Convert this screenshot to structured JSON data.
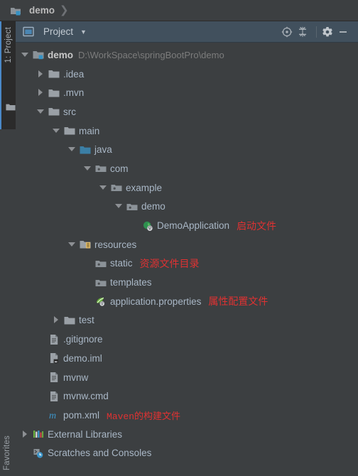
{
  "breadcrumb": {
    "items": [
      {
        "label": "demo",
        "icon": "module-folder-icon"
      }
    ],
    "separator": "❯"
  },
  "left_rail": {
    "project_tab_label": "1: Project",
    "favorites_label": "Favorites",
    "folder_icon": "folder-icon"
  },
  "tool_window": {
    "title": "Project",
    "title_icon": "project-window-icon",
    "dropdown_chevron": "▼",
    "buttons": [
      {
        "name": "locate-in-tree-button",
        "icon": "target-icon",
        "title": "Select Opened File"
      },
      {
        "name": "collapse-all-button",
        "icon": "collapse-all-icon",
        "title": "Collapse All"
      },
      {
        "name": "settings-button",
        "icon": "gear-icon",
        "title": "Settings"
      },
      {
        "name": "hide-button",
        "icon": "minimize-icon",
        "title": "Hide"
      }
    ]
  },
  "tree": {
    "rows": [
      {
        "indent": 0,
        "arrow": "expanded",
        "icon": "module-folder-icon",
        "label": "demo",
        "bold": true,
        "sub": "D:\\WorkSpace\\springBootPro\\demo",
        "note": ""
      },
      {
        "indent": 1,
        "arrow": "collapsed",
        "icon": "folder-icon",
        "label": ".idea",
        "bold": false,
        "sub": "",
        "note": ""
      },
      {
        "indent": 1,
        "arrow": "collapsed",
        "icon": "folder-icon",
        "label": ".mvn",
        "bold": false,
        "sub": "",
        "note": ""
      },
      {
        "indent": 1,
        "arrow": "expanded",
        "icon": "folder-icon",
        "label": "src",
        "bold": false,
        "sub": "",
        "note": ""
      },
      {
        "indent": 2,
        "arrow": "expanded",
        "icon": "folder-icon",
        "label": "main",
        "bold": false,
        "sub": "",
        "note": ""
      },
      {
        "indent": 3,
        "arrow": "expanded",
        "icon": "source-root-icon",
        "label": "java",
        "bold": false,
        "sub": "",
        "note": ""
      },
      {
        "indent": 4,
        "arrow": "expanded",
        "icon": "package-icon",
        "label": "com",
        "bold": false,
        "sub": "",
        "note": ""
      },
      {
        "indent": 5,
        "arrow": "expanded",
        "icon": "package-icon",
        "label": "example",
        "bold": false,
        "sub": "",
        "note": ""
      },
      {
        "indent": 6,
        "arrow": "expanded",
        "icon": "package-icon",
        "label": "demo",
        "bold": false,
        "sub": "",
        "note": ""
      },
      {
        "indent": 7,
        "arrow": "none",
        "icon": "spring-boot-class-icon",
        "label": "DemoApplication",
        "bold": false,
        "sub": "",
        "note": "启动文件"
      },
      {
        "indent": 3,
        "arrow": "expanded",
        "icon": "resource-root-icon",
        "label": "resources",
        "bold": false,
        "sub": "",
        "note": ""
      },
      {
        "indent": 4,
        "arrow": "none",
        "icon": "package-icon",
        "label": "static",
        "bold": false,
        "sub": "",
        "note": "资源文件目录"
      },
      {
        "indent": 4,
        "arrow": "none",
        "icon": "package-icon",
        "label": "templates",
        "bold": false,
        "sub": "",
        "note": ""
      },
      {
        "indent": 4,
        "arrow": "none",
        "icon": "spring-properties-icon",
        "label": "application.properties",
        "bold": false,
        "sub": "",
        "note": "属性配置文件"
      },
      {
        "indent": 2,
        "arrow": "collapsed",
        "icon": "folder-icon",
        "label": "test",
        "bold": false,
        "sub": "",
        "note": ""
      },
      {
        "indent": 1,
        "arrow": "none",
        "icon": "text-file-icon",
        "label": ".gitignore",
        "bold": false,
        "sub": "",
        "note": ""
      },
      {
        "indent": 1,
        "arrow": "none",
        "icon": "iml-file-icon",
        "label": "demo.iml",
        "bold": false,
        "sub": "",
        "note": ""
      },
      {
        "indent": 1,
        "arrow": "none",
        "icon": "text-file-icon",
        "label": "mvnw",
        "bold": false,
        "sub": "",
        "note": ""
      },
      {
        "indent": 1,
        "arrow": "none",
        "icon": "text-file-icon",
        "label": "mvnw.cmd",
        "bold": false,
        "sub": "",
        "note": ""
      },
      {
        "indent": 1,
        "arrow": "none",
        "icon": "maven-file-icon",
        "label": "pom.xml",
        "bold": false,
        "sub": "",
        "note": "Maven的构建文件",
        "note_mono": true
      },
      {
        "indent": 0,
        "arrow": "collapsed",
        "icon": "external-libraries-icon",
        "label": "External Libraries",
        "bold": false,
        "sub": "",
        "note": ""
      },
      {
        "indent": 0,
        "arrow": "none",
        "icon": "scratches-icon",
        "label": "Scratches and Consoles",
        "bold": false,
        "sub": "",
        "note": ""
      }
    ]
  },
  "colors": {
    "background": "#3c3f41",
    "header": "#41505d",
    "text": "#a9b7c6",
    "accent": "#4a88c7",
    "annotation": "#e03232",
    "source_root": "#3b7fa6"
  }
}
